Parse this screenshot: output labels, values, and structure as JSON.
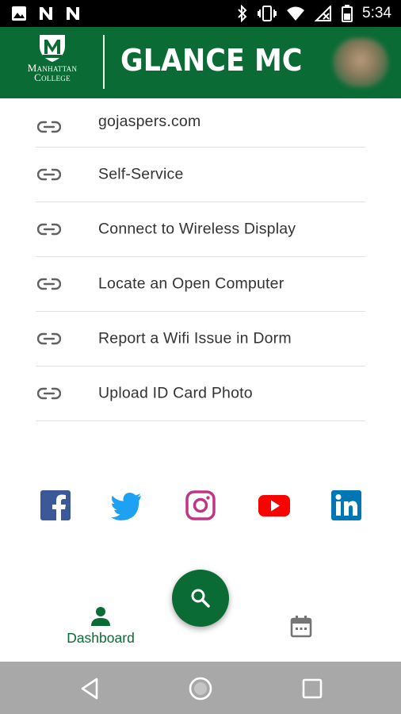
{
  "status_bar": {
    "time": "5:34",
    "left_icons": [
      "image-icon",
      "notification-n-icon",
      "notification-n-icon"
    ],
    "right_icons": [
      "bluetooth-icon",
      "vibrate-icon",
      "wifi-icon",
      "no-signal-icon",
      "battery-icon"
    ]
  },
  "header": {
    "logo_line1": "Manhattan",
    "logo_line2": "College",
    "title": "GLANCE MC",
    "background_color": "#0b6b35"
  },
  "links": [
    {
      "label": "gojaspers.com",
      "icon": "link-icon"
    },
    {
      "label": "Self-Service",
      "icon": "link-icon"
    },
    {
      "label": "Connect to Wireless Display",
      "icon": "link-icon"
    },
    {
      "label": "Locate an Open Computer",
      "icon": "link-icon"
    },
    {
      "label": "Report a Wifi Issue in Dorm",
      "icon": "link-icon"
    },
    {
      "label": "Upload ID Card Photo",
      "icon": "link-icon"
    }
  ],
  "social": [
    {
      "name": "facebook-icon",
      "color": "#3b5998"
    },
    {
      "name": "twitter-icon",
      "color": "#1da1f2"
    },
    {
      "name": "instagram-icon",
      "color": "#c13584"
    },
    {
      "name": "youtube-icon",
      "color": "#ff0000"
    },
    {
      "name": "linkedin-icon",
      "color": "#0077b5"
    }
  ],
  "bottom_nav": {
    "dashboard_label": "Dashboard",
    "active_color": "#0b6b35",
    "fab_icon": "search-icon",
    "calendar_icon": "calendar-icon"
  },
  "android_nav": [
    "back-icon",
    "home-icon",
    "recents-icon"
  ]
}
